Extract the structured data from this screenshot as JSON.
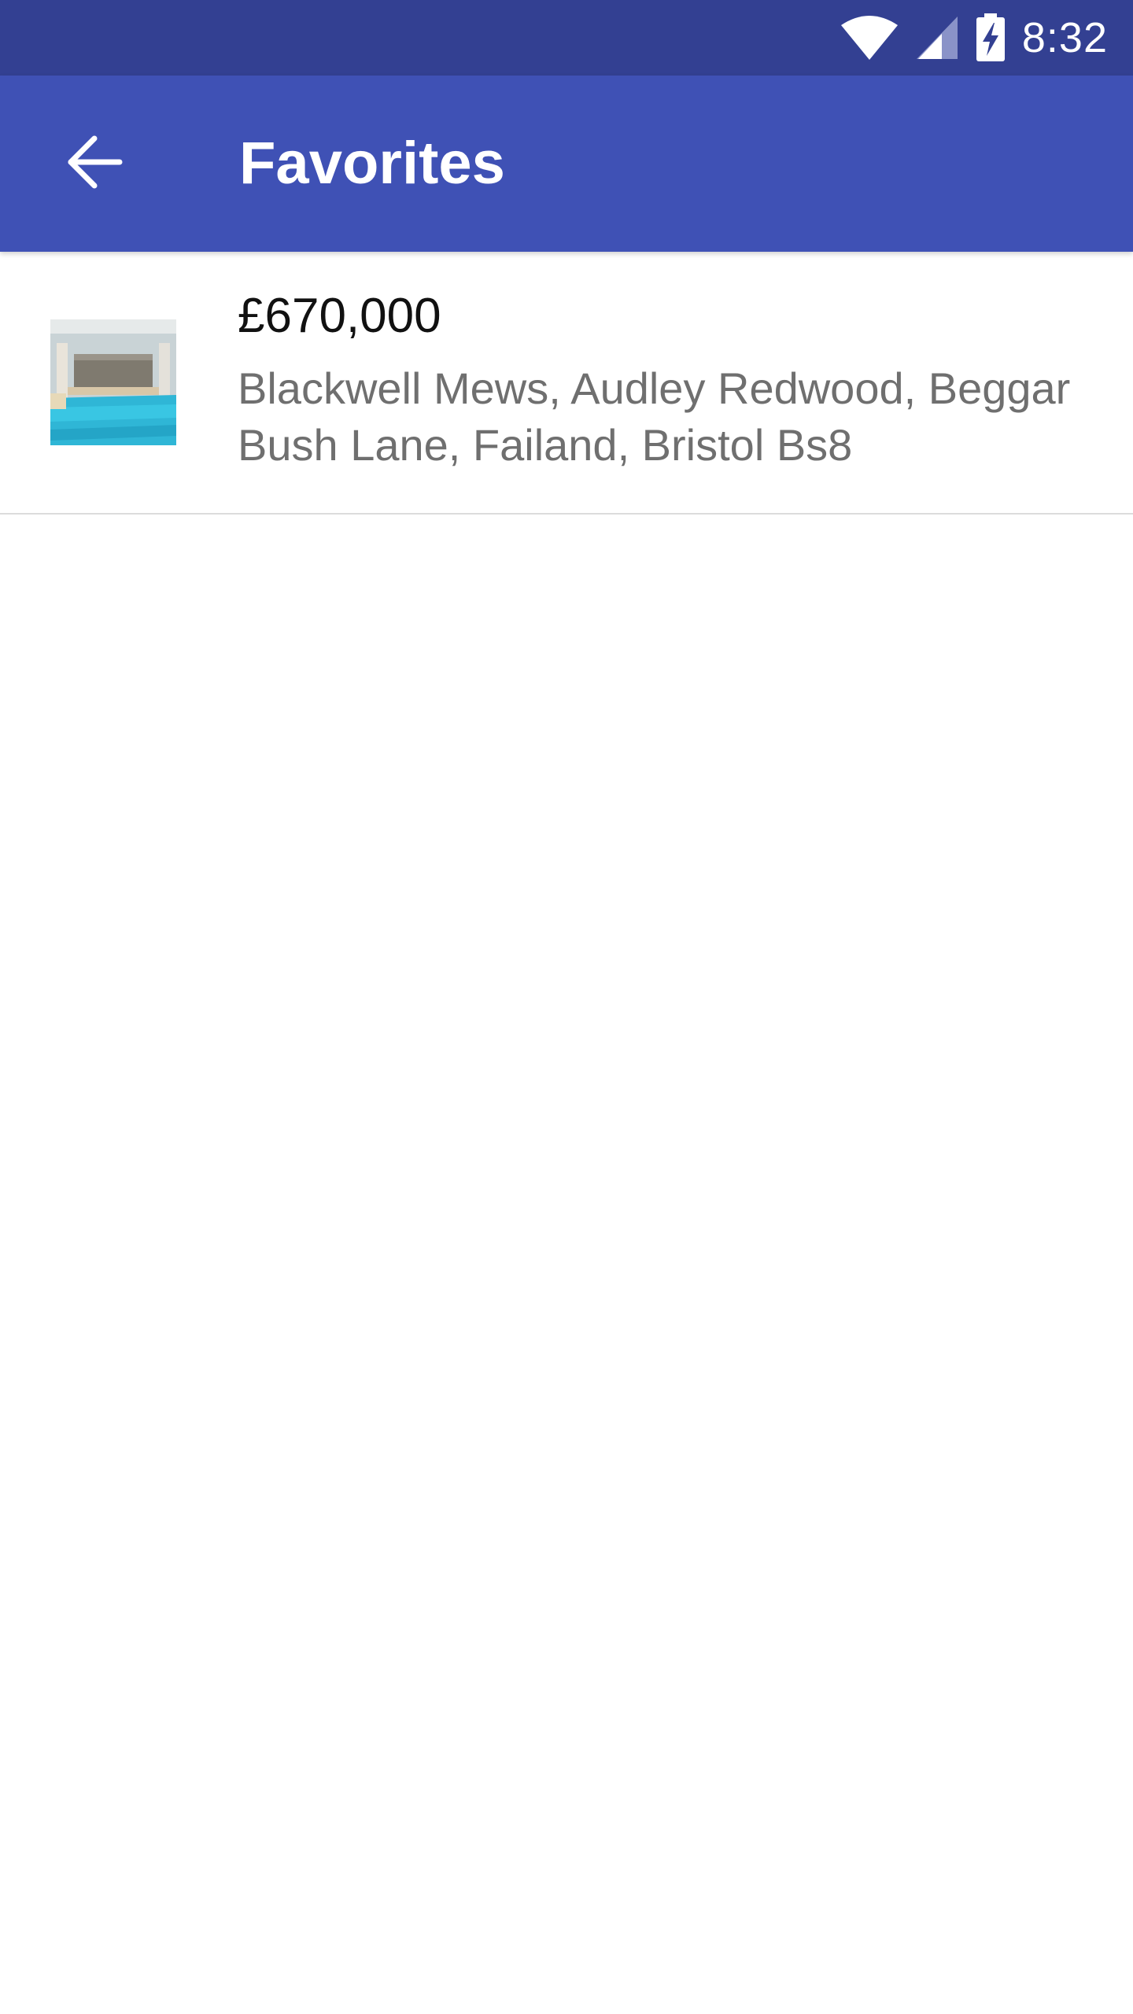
{
  "status_bar": {
    "time": "8:32",
    "icons": [
      "wifi-icon",
      "cell-signal-icon",
      "battery-charging-icon"
    ]
  },
  "app_bar": {
    "back_icon": "arrow-back-icon",
    "title": "Favorites"
  },
  "colors": {
    "status_bar": "#334092",
    "app_bar": "#3f51b5",
    "price_text": "#111111",
    "address_text": "#6f6f6f",
    "divider": "#dcdcdc"
  },
  "favorites": [
    {
      "thumbnail": "property-photo-indoor-pool",
      "price": "£670,000",
      "address": "Blackwell Mews, Audley Redwood, Beggar Bush Lane, Failand, Bristol Bs8"
    }
  ]
}
